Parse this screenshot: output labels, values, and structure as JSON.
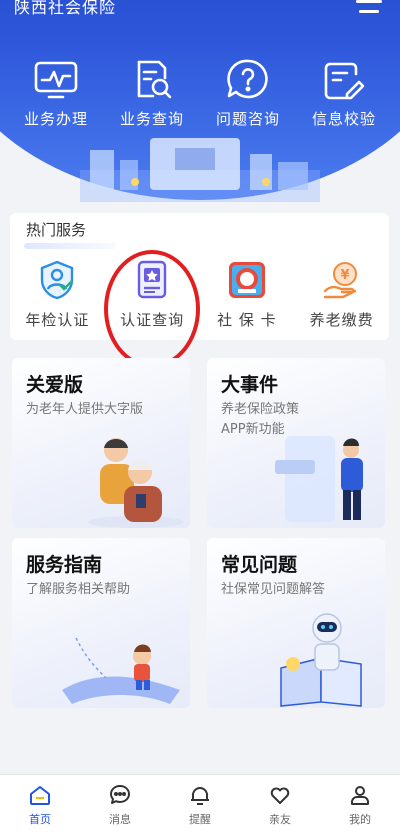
{
  "header": {
    "title": "陕西社会保险",
    "quick_actions": [
      {
        "label": "业务办理",
        "icon": "monitor-chart-icon"
      },
      {
        "label": "业务查询",
        "icon": "document-search-icon"
      },
      {
        "label": "问题咨询",
        "icon": "question-bubble-icon"
      },
      {
        "label": "信息校验",
        "icon": "document-edit-icon"
      }
    ]
  },
  "hot_services": {
    "title": "热门服务",
    "items": [
      {
        "label": "年检认证",
        "icon": "shield-person-icon"
      },
      {
        "label": "认证查询",
        "icon": "certificate-star-icon"
      },
      {
        "label": "社 保 卡",
        "icon": "social-security-card-icon"
      },
      {
        "label": "养老缴费",
        "icon": "pension-payment-icon"
      }
    ]
  },
  "cards": [
    {
      "title": "关爱版",
      "subtitle": "为老年人提供大字版"
    },
    {
      "title": "大事件",
      "subtitle": "养老保险政策\nAPP新功能"
    },
    {
      "title": "服务指南",
      "subtitle": "了解服务相关帮助"
    },
    {
      "title": "常见问题",
      "subtitle": "社保常见问题解答"
    }
  ],
  "bottom_nav": [
    {
      "label": "首页",
      "active": true
    },
    {
      "label": "消息",
      "active": false
    },
    {
      "label": "提醒",
      "active": false
    },
    {
      "label": "亲友",
      "active": false
    },
    {
      "label": "我的",
      "active": false
    }
  ],
  "colors": {
    "brand": "#1f3fb6",
    "accent": "#1f55e0",
    "highlight": "#e02020"
  }
}
